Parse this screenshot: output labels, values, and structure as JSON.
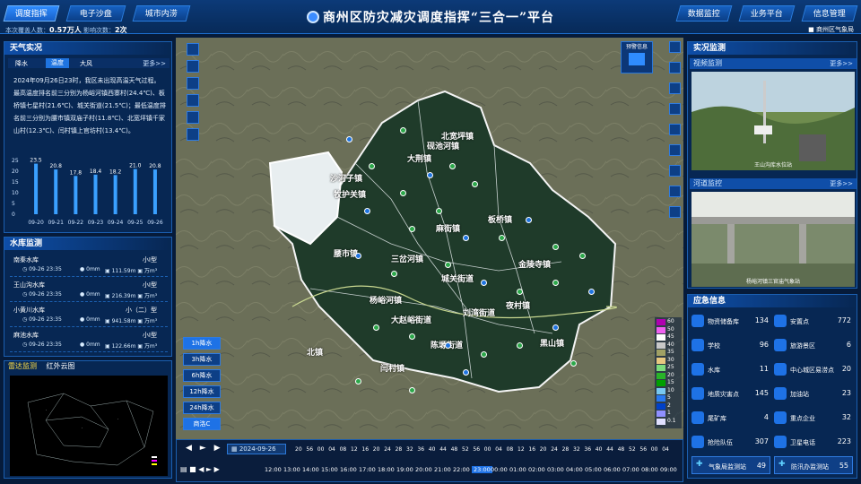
{
  "header": {
    "title": "商州区防灾减灾调度指挥“三合一”平台",
    "left_tabs": [
      "调度指挥",
      "电子沙盘",
      "城市内涝"
    ],
    "right_tabs": [
      "数据监控",
      "业务平台",
      "信息管理"
    ],
    "user": "商州区气象局",
    "stats": {
      "label1": "本次覆盖人数：",
      "value1": "0.57万人",
      "label2": "影响次数：",
      "value2": "2次"
    }
  },
  "weather": {
    "title": "天气实况",
    "more": "更多>>",
    "tabs": [
      "降水",
      "温度",
      "大风"
    ],
    "text": "2024年09月26日23时，我区未出现高温天气过程。最高温度排名前三分别为杨峪河镇西寨村(24.4℃)、板桥镇七星村(21.6℃)、城关街道(21.5℃)；最低温度排名前三分别为腰市镇双庙子村(11.8℃)、北宽坪镇千家山村(12.3℃)、闫村镇上官坊村(13.4℃)。",
    "yticks": [
      "25",
      "20",
      "15",
      "10",
      "5",
      "0"
    ]
  },
  "chart_data": {
    "type": "bar",
    "categories": [
      "09-20",
      "09-21",
      "09-22",
      "09-23",
      "09-24",
      "09-25",
      "09-26"
    ],
    "values": [
      23.5,
      20.8,
      17.8,
      18.4,
      18.2,
      21.0,
      20.8
    ],
    "ylim": [
      0,
      25
    ]
  },
  "reservoir": {
    "title": "水库监测",
    "items": [
      {
        "name": "南秦水库",
        "time": "09-26 23:35",
        "rain": "0mm",
        "vol": "111.59m",
        "cap": "万m³",
        "type": "小Ⅰ型"
      },
      {
        "name": "王山沟水库",
        "time": "09-26 23:35",
        "rain": "0mm",
        "vol": "216.39m",
        "cap": "万m³",
        "type": "小Ⅰ型"
      },
      {
        "name": "小黄川水库",
        "time": "09-26 23:35",
        "rain": "0mm",
        "vol": "941.58m",
        "cap": "万m³",
        "type": "小（二）型"
      },
      {
        "name": "麻池水库",
        "time": "09-26 23:35",
        "rain": "0mm",
        "vol": "122.66m",
        "cap": "万m³",
        "type": "小Ⅰ型"
      }
    ]
  },
  "radar": {
    "tabs": [
      "雷达监测",
      "红外云图"
    ]
  },
  "map": {
    "warn": "预警信息",
    "towns": [
      "沙河子镇",
      "大荆镇",
      "牧护关镇",
      "砚池河镇",
      "北宽坪镇",
      "板桥镇",
      "麻街镇",
      "三岔河镇",
      "杨峪河镇",
      "城关街道",
      "刘湾街道",
      "腰市镇",
      "金陵寺镇",
      "大赵峪街道",
      "夜村镇",
      "黑山镇",
      "陈塬街道",
      "闫村镇",
      "北镇"
    ],
    "rain_buttons": [
      "1h降水",
      "3h降水",
      "6h降水",
      "12h降水",
      "24h降水",
      "商洛C"
    ],
    "legend": [
      "60",
      "50",
      "45",
      "40",
      "35",
      "30",
      "25",
      "20",
      "15",
      "10",
      "5",
      "2",
      "1",
      "0.1"
    ]
  },
  "timeline": {
    "date": "2024-09-26",
    "hours": [
      "12:00",
      "13:00",
      "14:00",
      "15:00",
      "16:00",
      "17:00",
      "18:00",
      "19:00",
      "20:00",
      "21:00",
      "22:00",
      "23:00",
      "00:00",
      "01:00",
      "02:00",
      "03:00",
      "04:00",
      "05:00",
      "06:00",
      "07:00",
      "08:00",
      "09:00"
    ],
    "mins": [
      "20",
      "56",
      "00",
      "04",
      "08",
      "12",
      "16",
      "20",
      "24",
      "28",
      "32",
      "36",
      "40",
      "44",
      "48",
      "52",
      "56",
      "00",
      "04",
      "08",
      "12",
      "16",
      "20",
      "24",
      "28",
      "32",
      "36",
      "40",
      "44",
      "48",
      "52",
      "56",
      "00",
      "04"
    ]
  },
  "live": {
    "title": "实况监测",
    "video": "视频监测",
    "video_cap": "王山沟库水位站",
    "river": "河道监控",
    "river_cap": "杨峪河镇三官庙气象站",
    "more": "更多>>"
  },
  "emergency": {
    "title": "应急信息",
    "items": [
      [
        "物资储备库",
        "134"
      ],
      [
        "安置点",
        "772"
      ],
      [
        "学校",
        "96"
      ],
      [
        "旅游景区",
        "6"
      ],
      [
        "水库",
        "11"
      ],
      [
        "中心城区易涝点",
        "20"
      ],
      [
        "地质灾害点",
        "145"
      ],
      [
        "加油站",
        "23"
      ],
      [
        "尾矿库",
        "4"
      ],
      [
        "重点企业",
        "32"
      ],
      [
        "抢险队伍",
        "307"
      ],
      [
        "卫星电话",
        "223"
      ]
    ],
    "footer": [
      [
        "气象局监测站",
        "49"
      ],
      [
        "防汛办监测站",
        "55"
      ]
    ]
  }
}
